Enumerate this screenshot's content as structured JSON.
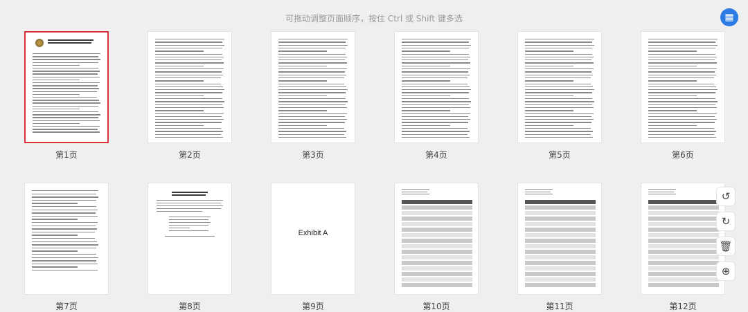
{
  "hint": "可拖动调整页面顺序，按住 Ctrl 或 Shift 键多选",
  "pages": [
    {
      "label": "第1页",
      "kind": "letter",
      "selected": true
    },
    {
      "label": "第2页",
      "kind": "text"
    },
    {
      "label": "第3页",
      "kind": "text"
    },
    {
      "label": "第4页",
      "kind": "text"
    },
    {
      "label": "第5页",
      "kind": "text"
    },
    {
      "label": "第6页",
      "kind": "text"
    },
    {
      "label": "第7页",
      "kind": "text-sparse"
    },
    {
      "label": "第8页",
      "kind": "cert"
    },
    {
      "label": "第9页",
      "kind": "exhibit",
      "text": "Exhibit A"
    },
    {
      "label": "第10页",
      "kind": "table"
    },
    {
      "label": "第11页",
      "kind": "table"
    },
    {
      "label": "第12页",
      "kind": "table"
    }
  ],
  "side_tools": [
    {
      "name": "rotate-left",
      "glyph": "↺"
    },
    {
      "name": "rotate-right",
      "glyph": "↻"
    },
    {
      "name": "delete",
      "glyph": "🗑"
    },
    {
      "name": "insert",
      "glyph": "⊕"
    }
  ],
  "fab_icon": "page-export-icon"
}
